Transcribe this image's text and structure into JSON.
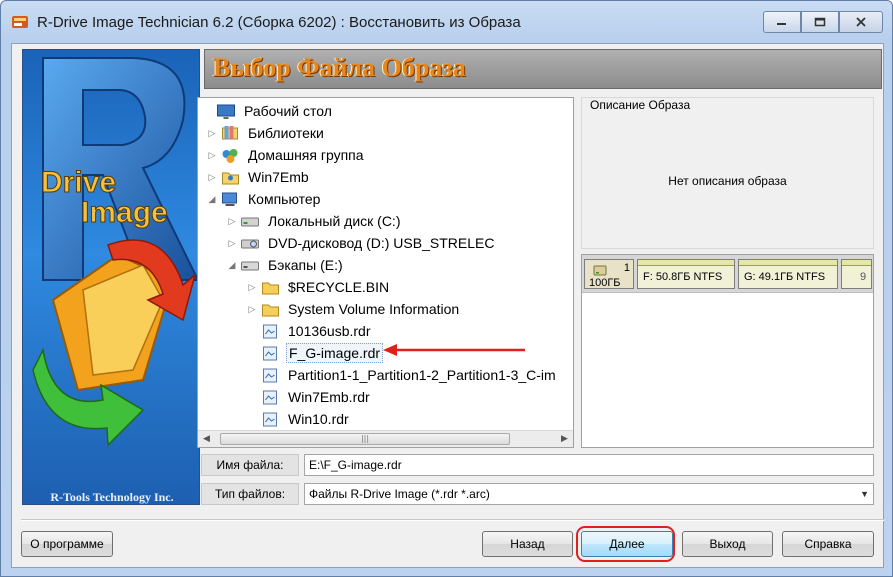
{
  "window": {
    "title": "R-Drive Image Technician 6.2 (Сборка 6202) : Восстановить из Образа"
  },
  "banner": {
    "company": "R-Tools Technology Inc."
  },
  "header": {
    "title": "Выбор Файла Образа"
  },
  "tree": [
    {
      "label": "Рабочий стол",
      "icon": "desktop-icon",
      "level": 0,
      "expander": ""
    },
    {
      "label": "Библиотеки",
      "icon": "libraries-icon",
      "level": 1,
      "expander": "▷"
    },
    {
      "label": "Домашняя группа",
      "icon": "homegroup-icon",
      "level": 1,
      "expander": "▷"
    },
    {
      "label": "Win7Emb",
      "icon": "user-folder-icon",
      "level": 1,
      "expander": "▷"
    },
    {
      "label": "Компьютер",
      "icon": "computer-icon",
      "level": 1,
      "expander": "◢"
    },
    {
      "label": "Локальный диск (C:)",
      "icon": "local-disk-icon",
      "level": 2,
      "expander": "▷"
    },
    {
      "label": "DVD-дисковод (D:) USB_STRELEC",
      "icon": "dvd-drive-icon",
      "level": 2,
      "expander": "▷"
    },
    {
      "label": "Бэкапы (E:)",
      "icon": "drive-icon",
      "level": 2,
      "expander": "◢"
    },
    {
      "label": "$RECYCLE.BIN",
      "icon": "folder-icon",
      "level": 3,
      "expander": "▷"
    },
    {
      "label": "System Volume Information",
      "icon": "folder-icon",
      "level": 3,
      "expander": "▷"
    },
    {
      "label": "10136usb.rdr",
      "icon": "image-file-icon",
      "level": 3,
      "expander": ""
    },
    {
      "label": "F_G-image.rdr",
      "icon": "image-file-icon",
      "level": 3,
      "expander": "",
      "selected": true
    },
    {
      "label": "Partition1-1_Partition1-2_Partition1-3_C-im",
      "icon": "image-file-icon",
      "level": 3,
      "expander": ""
    },
    {
      "label": "Win7Emb.rdr",
      "icon": "image-file-icon",
      "level": 3,
      "expander": ""
    },
    {
      "label": "Win10.rdr",
      "icon": "image-file-icon",
      "level": 3,
      "expander": ""
    }
  ],
  "description": {
    "title": "Описание Образа",
    "text": "Нет описания образа"
  },
  "disk_map": {
    "disk_number": "1",
    "disk_size": "100ГБ",
    "partitions": [
      {
        "label": "F:  50.8ГБ  NTFS"
      },
      {
        "label": "G:  49.1ГБ  NTFS"
      },
      {
        "label": "9"
      }
    ]
  },
  "file_name": {
    "label": "Имя файла:",
    "value": "E:\\F_G-image.rdr"
  },
  "file_type": {
    "label": "Тип файлов:",
    "value": "Файлы R-Drive Image (*.rdr *.arc)"
  },
  "buttons": {
    "about": "О программе",
    "back": "Назад",
    "next": "Далее",
    "exit": "Выход",
    "help": "Справка"
  },
  "colors": {
    "header_text": "#e8861e",
    "annotation_red": "#e0201a",
    "banner_blue": "#2f8ae0"
  }
}
